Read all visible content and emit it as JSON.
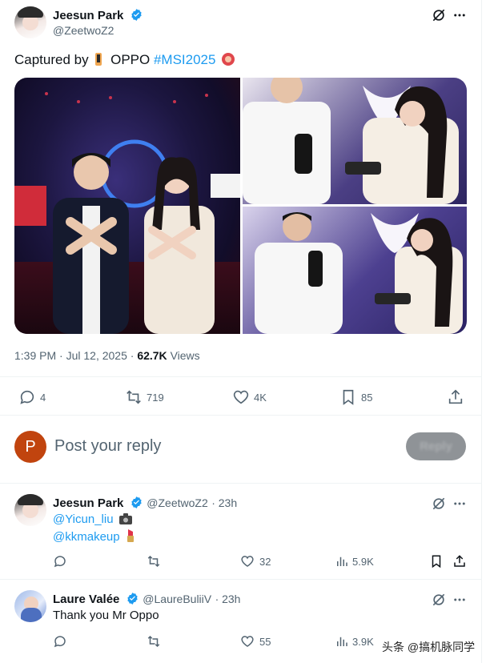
{
  "main_tweet": {
    "author_name": "Jeesun Park",
    "author_handle": "@ZeetwoZ2",
    "text_prefix": "Captured by",
    "text_brand": "OPPO",
    "hashtag": "#MSI2025",
    "time": "1:39 PM · Jul 12, 2025 · ",
    "views_count": "62.7K",
    "views_label": "Views",
    "stats": {
      "replies": "4",
      "reposts": "719",
      "likes": "4K",
      "bookmarks": "85"
    }
  },
  "reply_composer": {
    "avatar_letter": "P",
    "placeholder": "Post your reply",
    "button_label": "Reply"
  },
  "replies": [
    {
      "author_name": "Jeesun Park",
      "author_handle": "@ZeetwoZ2",
      "time": "· 23h",
      "mention1": "@Yicun_liu",
      "mention2": "@kkmakeup",
      "stats": {
        "replies": "",
        "reposts": "",
        "likes": "32",
        "views": "5.9K"
      }
    },
    {
      "author_name": "Laure Valée",
      "author_handle": "@LaureBuliiV",
      "time": "· 23h",
      "text": "Thank you Mr Oppo",
      "stats": {
        "replies": "",
        "reposts": "",
        "likes": "55",
        "views": "3.9K"
      }
    }
  ],
  "watermark": "头条 @搞机脉同学",
  "colors": {
    "accent": "#1d9bf0",
    "text": "#0f1419",
    "muted": "#536471",
    "reply_avatar": "#c1440e"
  }
}
